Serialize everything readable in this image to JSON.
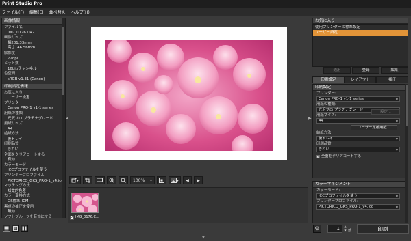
{
  "app": {
    "title": "Print Studio Pro"
  },
  "menu": [
    "ファイル(F)",
    "編集(E)",
    "並べ替え",
    "ヘルプ(H)"
  ],
  "left_panel": {
    "sections": [
      {
        "title": "画像情報",
        "rows": [
          {
            "text": "ファイル名",
            "indent": false
          },
          {
            "text": "IMG_0176.CR2",
            "indent": true
          },
          {
            "text": "画像サイズ",
            "indent": false
          },
          {
            "text": "幅201.33mm",
            "indent": true
          },
          {
            "text": "高さ146.56mm",
            "indent": true
          },
          {
            "text": "解像度",
            "indent": false
          },
          {
            "text": "72dpi",
            "indent": true
          },
          {
            "text": "ビット数",
            "indent": false
          },
          {
            "text": "16bit/チャンネル",
            "indent": true
          },
          {
            "text": "色空間",
            "indent": false
          },
          {
            "text": "sRGB v1.31 (Canon)",
            "indent": true
          }
        ]
      },
      {
        "title": "印刷設定情報",
        "rows": [
          {
            "text": "お気に入り",
            "indent": false
          },
          {
            "text": "ユーザー設定",
            "indent": true
          },
          {
            "text": "プリンター",
            "indent": false
          },
          {
            "text": "Canon PRO-1 v1-1 series",
            "indent": true
          },
          {
            "text": "用紙の種類",
            "indent": false
          },
          {
            "text": "光沢プロ プラチナグレード",
            "indent": true
          },
          {
            "text": "用紙サイズ",
            "indent": false
          },
          {
            "text": "A4",
            "indent": true
          },
          {
            "text": "給紙方法",
            "indent": false
          },
          {
            "text": "後トレイ",
            "indent": true
          },
          {
            "text": "印刷品質",
            "indent": false
          },
          {
            "text": "きれい",
            "indent": true
          },
          {
            "text": "全面をクリアコートする",
            "indent": false
          },
          {
            "text": "有効",
            "indent": true
          },
          {
            "text": "カラーモード",
            "indent": false
          },
          {
            "text": "ICCプロファイルを使う",
            "indent": true
          },
          {
            "text": "プリンタープロファイル",
            "indent": false
          },
          {
            "text": "PICTORICO_GKS_PRO-1_v4.icc",
            "indent": true
          },
          {
            "text": "マッチング方法",
            "indent": false
          },
          {
            "text": "知覚的色差",
            "indent": true
          },
          {
            "text": "カラー変換方式",
            "indent": false
          },
          {
            "text": "OS標準(ICM)",
            "indent": true
          },
          {
            "text": "黒点の補正を使用",
            "indent": false
          },
          {
            "text": "無効",
            "indent": true
          },
          {
            "text": "ソフトプルーフを有効にする",
            "indent": false
          },
          {
            "text": "無効",
            "indent": true
          }
        ]
      }
    ]
  },
  "toolbar": {
    "zoom": "100%"
  },
  "thumbnail": {
    "label": "IMG_0176.C..."
  },
  "right_panel": {
    "favorites_title": "お気に入り",
    "favorites": [
      "使用プリンターの標準設定",
      "ユーザー設定"
    ],
    "fav_buttons": [
      "適用",
      "登録",
      "編集"
    ],
    "tabs": [
      "印刷設定",
      "レイアウト",
      "補正"
    ],
    "settings_title": "印刷設定",
    "printer_label": "プリンター:",
    "printer_value": "Canon PRO-1 v1-1 series",
    "paper_type_label": "用紙の種類:",
    "paper_type_value": "光沢プロ プラチナグレード",
    "paper_size_label": "用紙サイズ:",
    "paper_size_value": "A4",
    "user_size_button": "ユーザー定義用紙...",
    "feed_label": "給紙方法:",
    "feed_value": "後トレイ",
    "quality_label": "印刷品質:",
    "quality_value": "きれい",
    "settings_button": "設定...",
    "clearcoat_label": "全面をクリアコートする",
    "cm_title": "カラーマネジメント",
    "color_mode_label": "カラーモード:",
    "color_mode_value": "ICCプロファイルを使う",
    "profile_label": "プリンタープロファイル:",
    "profile_value": "PICTORICO_GKS_PRO-1_v4.icc"
  },
  "print": {
    "copies": "1",
    "unit": "部",
    "button": "印刷"
  }
}
